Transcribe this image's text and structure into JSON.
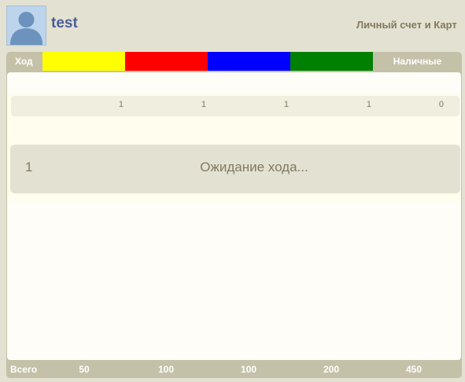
{
  "user": {
    "name": "test"
  },
  "account": {
    "label": "Личный счет и Карт"
  },
  "table": {
    "turn_label": "Ход",
    "player_colors": [
      "#ffff00",
      "#ff0000",
      "#0000ff",
      "#008000"
    ],
    "cash_label": "Наличные",
    "counts": [
      "1",
      "1",
      "1",
      "1"
    ],
    "cash_count": "0",
    "total_label": "Всего",
    "totals": [
      "50",
      "100",
      "100",
      "200"
    ],
    "total_cash": "450"
  },
  "status": {
    "number": "1",
    "text": "Ожидание хода..."
  }
}
